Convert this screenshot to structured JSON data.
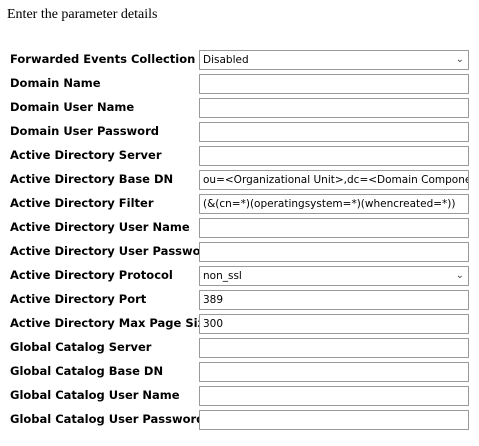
{
  "heading": "Enter the parameter details",
  "icons": {
    "dropdown": "chevron-down-icon"
  },
  "fields": [
    {
      "label": "Forwarded Events Collection",
      "type": "select",
      "value": "Disabled"
    },
    {
      "label": "Domain Name",
      "type": "text",
      "value": ""
    },
    {
      "label": "Domain User Name",
      "type": "text",
      "value": ""
    },
    {
      "label": "Domain User Password",
      "type": "text",
      "value": ""
    },
    {
      "label": "Active Directory Server",
      "type": "text",
      "value": ""
    },
    {
      "label": "Active Directory Base DN",
      "type": "text",
      "value": "ou=<Organizational Unit>,dc=<Domain Component>,"
    },
    {
      "label": "Active Directory Filter",
      "type": "text",
      "value": "(&(cn=*)(operatingsystem=*)(whencreated=*))"
    },
    {
      "label": "Active Directory User Name",
      "type": "text",
      "value": ""
    },
    {
      "label": "Active Directory User Password",
      "type": "text",
      "value": ""
    },
    {
      "label": "Active Directory Protocol",
      "type": "select",
      "value": "non_ssl"
    },
    {
      "label": "Active Directory Port",
      "type": "text",
      "value": "389"
    },
    {
      "label": "Active Directory Max Page Size",
      "type": "text",
      "value": "300"
    },
    {
      "label": "Global Catalog Server",
      "type": "text",
      "value": ""
    },
    {
      "label": "Global Catalog Base DN",
      "type": "text",
      "value": ""
    },
    {
      "label": "Global Catalog User Name",
      "type": "text",
      "value": ""
    },
    {
      "label": "Global Catalog User Password",
      "type": "text",
      "value": ""
    }
  ]
}
